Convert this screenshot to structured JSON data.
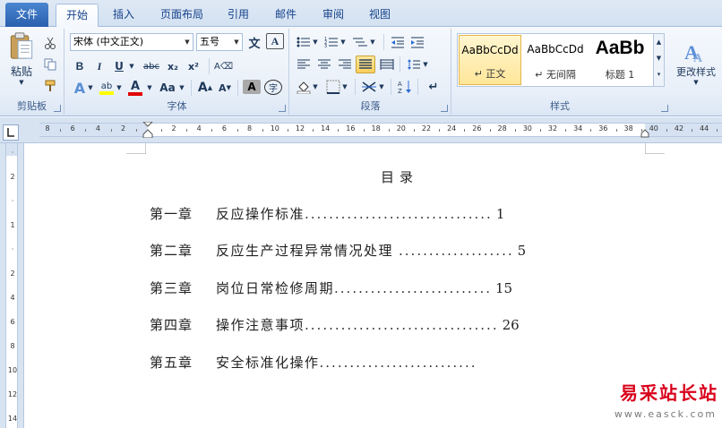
{
  "tabs": [
    {
      "label": "文件",
      "active": false
    },
    {
      "label": "开始",
      "active": true
    },
    {
      "label": "插入",
      "active": false
    },
    {
      "label": "页面布局",
      "active": false
    },
    {
      "label": "引用",
      "active": false
    },
    {
      "label": "邮件",
      "active": false
    },
    {
      "label": "审阅",
      "active": false
    },
    {
      "label": "视图",
      "active": false
    }
  ],
  "clipboard": {
    "paste_label": "粘贴",
    "group_label": "剪贴板"
  },
  "font": {
    "name": "宋体 (中文正文)",
    "size": "五号",
    "group_label": "字体",
    "aa_label": "Aa",
    "big_a": "A",
    "small_a": "A"
  },
  "paragraph": {
    "group_label": "段落"
  },
  "styles": {
    "group_label": "样式",
    "change_label": "更改样式",
    "items": [
      {
        "sample": "AaBbCcDd",
        "name": "↵ 正文",
        "selected": true
      },
      {
        "sample": "AaBbCcDd",
        "name": "↵ 无间隔",
        "selected": false
      },
      {
        "sample": "AaBb",
        "name": "标题 1",
        "selected": false
      }
    ]
  },
  "ruler": {
    "h_ticks": [
      "8",
      "6",
      "4",
      "2",
      "",
      "2",
      "4",
      "6",
      "8",
      "10",
      "12",
      "14",
      "16",
      "18",
      "20",
      "22",
      "24",
      "26",
      "28",
      "30",
      "32",
      "34",
      "36",
      "38",
      "40",
      "42",
      "44"
    ],
    "v_ticks": [
      "",
      "2",
      "",
      "1",
      "",
      "2",
      "4",
      "6",
      "8",
      "10",
      "12",
      "14"
    ]
  },
  "document": {
    "title": "目录",
    "toc": [
      {
        "chapter": "第一章",
        "text": "反应操作标准",
        "dots": "...............................",
        "page": "1"
      },
      {
        "chapter": "第二章",
        "text": "反应生产过程异常情况处理",
        "dots": "...................",
        "page": "5"
      },
      {
        "chapter": "第三章",
        "text": "岗位日常检修周期",
        "dots": "..........................",
        "page": "15"
      },
      {
        "chapter": "第四章",
        "text": "操作注意事项",
        "dots": "................................",
        "page": "26"
      },
      {
        "chapter": "第五章",
        "text": "安全标准化操作",
        "dots": "..........................",
        "page": ""
      }
    ]
  },
  "watermark": {
    "name": "易采站长站",
    "url": "www.easck.com"
  }
}
